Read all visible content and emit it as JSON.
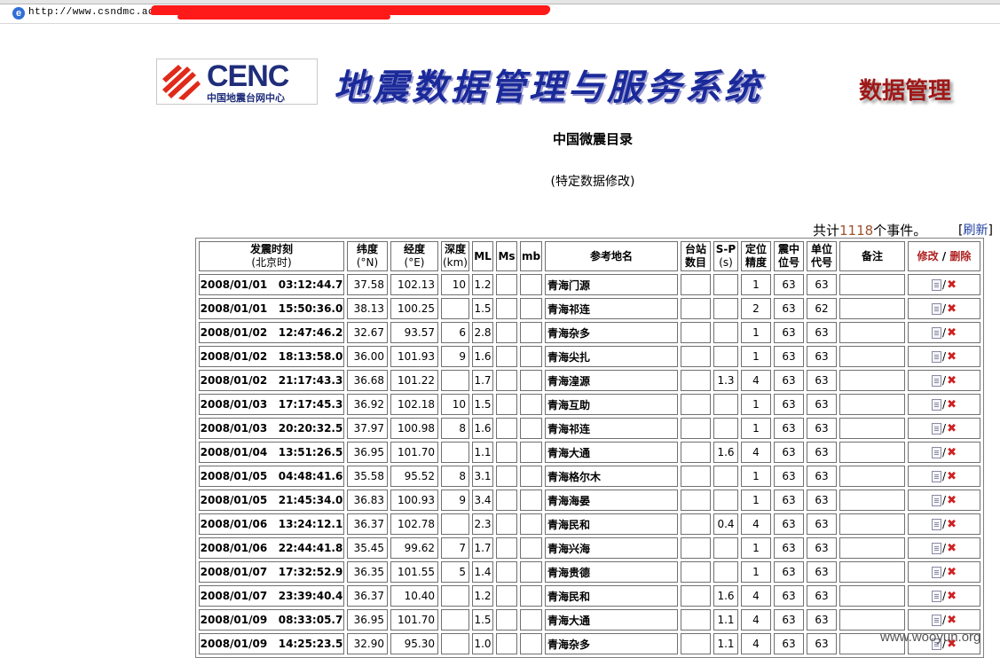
{
  "browser": {
    "url": "http://www.csndmc.ac.cn/"
  },
  "header": {
    "logo_brand": "CENC",
    "logo_sub": "中国地震台网中心",
    "system_title": "地震数据管理与服务系统",
    "section_title": "数据管理"
  },
  "page": {
    "title": "中国微震目录",
    "subtitle": "(特定数据修改)",
    "total_prefix": "共计",
    "total_count": "1118",
    "total_suffix": "个事件。",
    "refresh_label": "刷新"
  },
  "table": {
    "headers": {
      "time": "发震时刻",
      "time_sub": "(北京时)",
      "lat": "纬度",
      "lat_sub": "(°N)",
      "lon": "经度",
      "lon_sub": "(°E)",
      "depth": "深度",
      "depth_sub": "(km)",
      "ml": "ML",
      "ms": "Ms",
      "mb": "mb",
      "place": "参考地名",
      "stations": "台站",
      "stations_sub": "数目",
      "sp": "S-P",
      "sp_sub": "(s)",
      "precision": "定位",
      "precision_sub": "精度",
      "epicenter": "震中",
      "epicenter_sub": "位号",
      "unit": "单位",
      "unit_sub": "代号",
      "remarks": "备注",
      "edit": "修改",
      "sep": "/",
      "delete": "删除"
    },
    "rows": [
      {
        "time": "2008/01/01   03:12:44.7",
        "lat": "37.58",
        "lon": "102.13",
        "depth": "10",
        "ml": "1.2",
        "ms": "",
        "mb": "",
        "place": "青海门源",
        "stations": "",
        "sp": "",
        "precision": "1",
        "epicenter": "63",
        "unit": "63",
        "remarks": ""
      },
      {
        "time": "2008/01/01   15:50:36.0",
        "lat": "38.13",
        "lon": "100.25",
        "depth": "",
        "ml": "1.5",
        "ms": "",
        "mb": "",
        "place": "青海祁连",
        "stations": "",
        "sp": "",
        "precision": "2",
        "epicenter": "63",
        "unit": "62",
        "remarks": ""
      },
      {
        "time": "2008/01/02   12:47:46.2",
        "lat": "32.67",
        "lon": "93.57",
        "depth": "6",
        "ml": "2.8",
        "ms": "",
        "mb": "",
        "place": "青海杂多",
        "stations": "",
        "sp": "",
        "precision": "1",
        "epicenter": "63",
        "unit": "63",
        "remarks": ""
      },
      {
        "time": "2008/01/02   18:13:58.0",
        "lat": "36.00",
        "lon": "101.93",
        "depth": "9",
        "ml": "1.6",
        "ms": "",
        "mb": "",
        "place": "青海尖扎",
        "stations": "",
        "sp": "",
        "precision": "1",
        "epicenter": "63",
        "unit": "63",
        "remarks": ""
      },
      {
        "time": "2008/01/02   21:17:43.3",
        "lat": "36.68",
        "lon": "101.22",
        "depth": "",
        "ml": "1.7",
        "ms": "",
        "mb": "",
        "place": "青海湟源",
        "stations": "",
        "sp": "1.3",
        "precision": "4",
        "epicenter": "63",
        "unit": "63",
        "remarks": ""
      },
      {
        "time": "2008/01/03   17:17:45.3",
        "lat": "36.92",
        "lon": "102.18",
        "depth": "10",
        "ml": "1.5",
        "ms": "",
        "mb": "",
        "place": "青海互助",
        "stations": "",
        "sp": "",
        "precision": "1",
        "epicenter": "63",
        "unit": "63",
        "remarks": ""
      },
      {
        "time": "2008/01/03   20:20:32.5",
        "lat": "37.97",
        "lon": "100.98",
        "depth": "8",
        "ml": "1.6",
        "ms": "",
        "mb": "",
        "place": "青海祁连",
        "stations": "",
        "sp": "",
        "precision": "1",
        "epicenter": "63",
        "unit": "63",
        "remarks": ""
      },
      {
        "time": "2008/01/04   13:51:26.5",
        "lat": "36.95",
        "lon": "101.70",
        "depth": "",
        "ml": "1.1",
        "ms": "",
        "mb": "",
        "place": "青海大通",
        "stations": "",
        "sp": "1.6",
        "precision": "4",
        "epicenter": "63",
        "unit": "63",
        "remarks": ""
      },
      {
        "time": "2008/01/05   04:48:41.6",
        "lat": "35.58",
        "lon": "95.52",
        "depth": "8",
        "ml": "3.1",
        "ms": "",
        "mb": "",
        "place": "青海格尔木",
        "stations": "",
        "sp": "",
        "precision": "1",
        "epicenter": "63",
        "unit": "63",
        "remarks": ""
      },
      {
        "time": "2008/01/05   21:45:34.0",
        "lat": "36.83",
        "lon": "100.93",
        "depth": "9",
        "ml": "3.4",
        "ms": "",
        "mb": "",
        "place": "青海海晏",
        "stations": "",
        "sp": "",
        "precision": "1",
        "epicenter": "63",
        "unit": "63",
        "remarks": ""
      },
      {
        "time": "2008/01/06   13:24:12.1",
        "lat": "36.37",
        "lon": "102.78",
        "depth": "",
        "ml": "2.3",
        "ms": "",
        "mb": "",
        "place": "青海民和",
        "stations": "",
        "sp": "0.4",
        "precision": "4",
        "epicenter": "63",
        "unit": "63",
        "remarks": ""
      },
      {
        "time": "2008/01/06   22:44:41.8",
        "lat": "35.45",
        "lon": "99.62",
        "depth": "7",
        "ml": "1.7",
        "ms": "",
        "mb": "",
        "place": "青海兴海",
        "stations": "",
        "sp": "",
        "precision": "1",
        "epicenter": "63",
        "unit": "63",
        "remarks": ""
      },
      {
        "time": "2008/01/07   17:32:52.9",
        "lat": "36.35",
        "lon": "101.55",
        "depth": "5",
        "ml": "1.4",
        "ms": "",
        "mb": "",
        "place": "青海贵德",
        "stations": "",
        "sp": "",
        "precision": "1",
        "epicenter": "63",
        "unit": "63",
        "remarks": ""
      },
      {
        "time": "2008/01/07   23:39:40.4",
        "lat": "36.37",
        "lon": "10.40",
        "depth": "",
        "ml": "1.2",
        "ms": "",
        "mb": "",
        "place": "青海民和",
        "stations": "",
        "sp": "1.6",
        "precision": "4",
        "epicenter": "63",
        "unit": "63",
        "remarks": ""
      },
      {
        "time": "2008/01/09   08:33:05.7",
        "lat": "36.95",
        "lon": "101.70",
        "depth": "",
        "ml": "1.5",
        "ms": "",
        "mb": "",
        "place": "青海大通",
        "stations": "",
        "sp": "1.1",
        "precision": "4",
        "epicenter": "63",
        "unit": "63",
        "remarks": ""
      },
      {
        "time": "2008/01/09   14:25:23.5",
        "lat": "32.90",
        "lon": "95.30",
        "depth": "",
        "ml": "1.0",
        "ms": "",
        "mb": "",
        "place": "青海杂多",
        "stations": "",
        "sp": "1.1",
        "precision": "4",
        "epicenter": "63",
        "unit": "63",
        "remarks": ""
      }
    ]
  },
  "watermark": "www.wooyun.org",
  "colors": {
    "redaction": "#ff1a1a",
    "title_blue": "#1a2a9a",
    "section_red": "#a01818",
    "delete_red": "#d02020"
  }
}
